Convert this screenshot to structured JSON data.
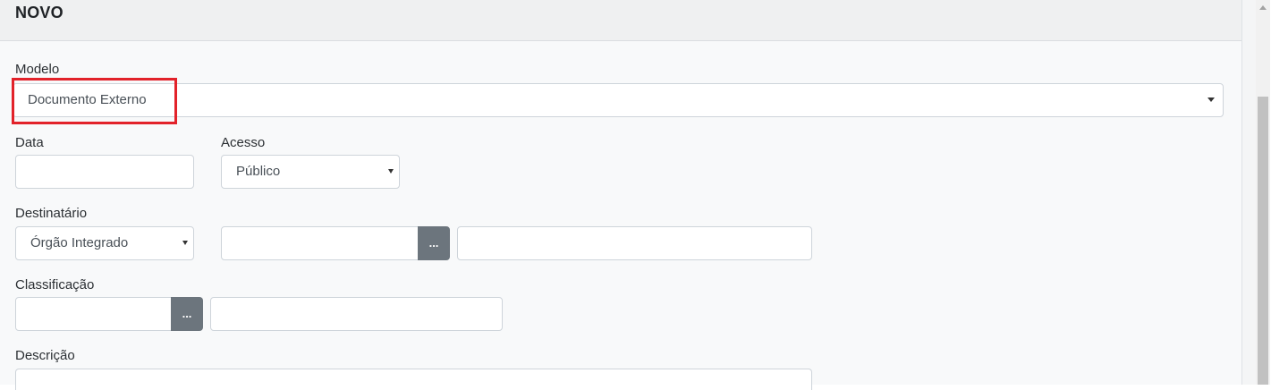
{
  "panel": {
    "title": "NOVO"
  },
  "form": {
    "modelo": {
      "label": "Modelo",
      "value": "Documento Externo"
    },
    "data": {
      "label": "Data",
      "value": ""
    },
    "acesso": {
      "label": "Acesso",
      "value": "Público"
    },
    "destinatario": {
      "label": "Destinatário",
      "type_value": "Órgão Integrado",
      "code_value": "",
      "name_value": "",
      "lookup_label": "..."
    },
    "classificacao": {
      "label": "Classificação",
      "code_value": "",
      "name_value": "",
      "lookup_label": "..."
    },
    "descricao": {
      "label": "Descrição",
      "value": ""
    }
  },
  "colors": {
    "highlight": "#e2222a",
    "lookup_button": "#6c757d"
  }
}
